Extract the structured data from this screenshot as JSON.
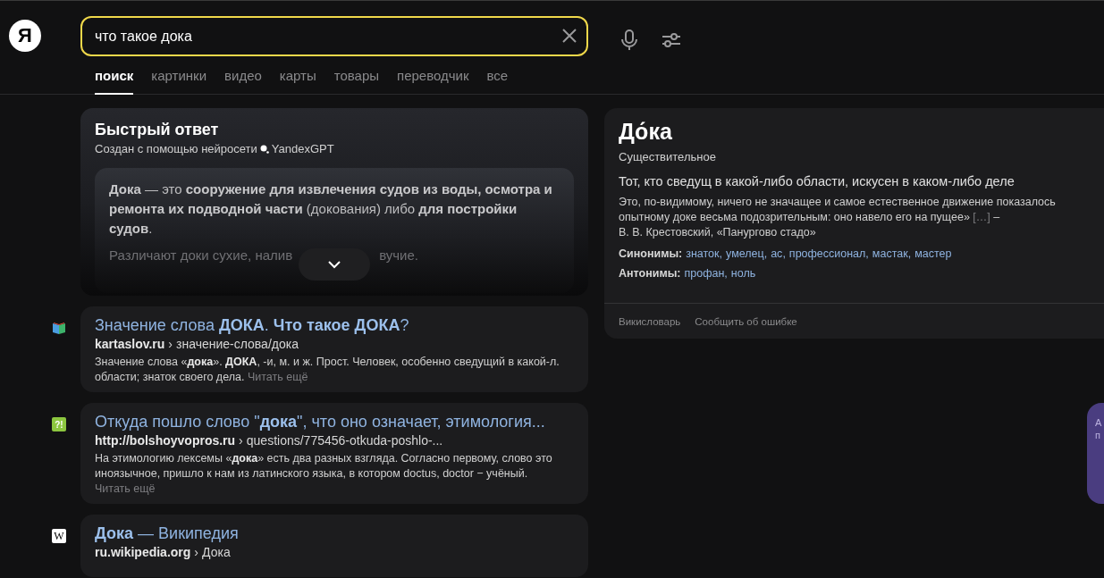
{
  "logo": {
    "letter": "Я"
  },
  "search": {
    "value": "что такое дока"
  },
  "tabs": [
    {
      "label": "поиск",
      "selected": true
    },
    {
      "label": "картинки",
      "selected": false
    },
    {
      "label": "видео",
      "selected": false
    },
    {
      "label": "карты",
      "selected": false
    },
    {
      "label": "товары",
      "selected": false
    },
    {
      "label": "переводчик",
      "selected": false
    },
    {
      "label": "все",
      "selected": false
    }
  ],
  "quick_answer": {
    "title": "Быстрый ответ",
    "subtitle": "Создан с помощью нейросети",
    "source": "YandexGPT",
    "paragraph": "**Дока** — это **сооружение для извлечения судов из воды, осмотра и ремонта их подводной части** (докования) либо **для постройки судов**.",
    "faded_left": "Различают доки сухие, налив",
    "faded_right": "вучие."
  },
  "results": [
    {
      "kind": "book",
      "title": "Значение слова **ДОКА**. **Что такое ДОКА**?",
      "domain": "kartaslov.ru",
      "separator": "›",
      "path": "значение-слова/дока",
      "snippet": "Значение слова «**дока**». **ДОКА**, -и, м. и ж. Прост. Человек, особенно сведущий в какой-л. области; знаток своего дела.",
      "more": "Читать ещё"
    },
    {
      "kind": "question",
      "glyph": "?!",
      "title": "Откуда пошло слово \"**дока**\", что оно означает, этимология...",
      "domain": "http://bolshoyvopros.ru",
      "separator": "›",
      "path": "questions/775456-otkuda-poshlo-...",
      "snippet": "На этимологию лексемы «**дока**» есть два разных взгляда. Согласно первому, слово это иноязычное, пришло к нам из латинского языка, в котором doctus, doctor − учёный.",
      "more": "Читать ещё"
    },
    {
      "kind": "wiki",
      "glyph": "W",
      "title": "**Дока** — Википедия",
      "domain": "ru.wikipedia.org",
      "separator": "›",
      "path": "Дока"
    }
  ],
  "dictionary": {
    "word": "До́ка",
    "part_of_speech": "Существительное",
    "definition": "Тот, кто сведущ в какой-либо области, искусен в каком-либо деле",
    "quote": "Это, по-видимому, ничего не значащее и самое естественное движение показалось опытному доке весьма подозрительным: оно навело его на пущее»",
    "quote_cut": "[…]",
    "quote_dash": "–",
    "quote_author": "В. В. Крестовский, «Панургово стадо»",
    "list_separator": ",",
    "synonyms_label": "Синонимы:",
    "synonyms": [
      "знаток",
      "умелец",
      "ас",
      "профессионал",
      "мастак",
      "мастер"
    ],
    "antonyms_label": "Антонимы:",
    "antonyms": [
      "профан",
      "ноль"
    ],
    "footer_links": [
      "Викисловарь",
      "Сообщить об ошибке"
    ]
  },
  "side_widget": {
    "lines": [
      "А",
      "п"
    ]
  }
}
